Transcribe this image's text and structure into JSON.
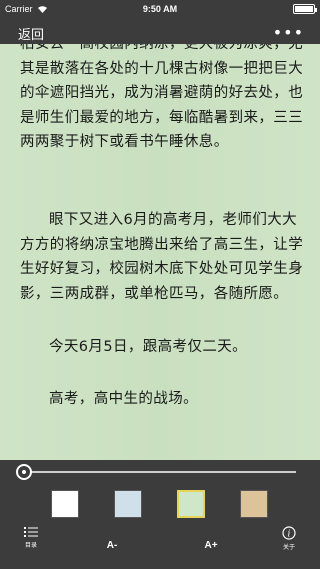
{
  "status_bar": {
    "carrier": "Carrier",
    "time": "9:50 AM"
  },
  "nav": {
    "back_label": "返回",
    "more_label": "•••"
  },
  "content": {
    "paragraphs": [
      "柏安去一高校园内纳凉，更大被为凉爽，尤其是散落在各处的十几棵古树像一把把巨大的伞遮阳挡光，成为消暑避荫的好去处，也是师生们最爱的地方，每临酷暑到来，三三两两聚于树下或看书午睡休息。",
      "眼下又进入6月的高考月，老师们大大方方的将纳凉宝地腾出来给了高三生，让学生好好复习，校园树木底下处处可见学生身影，三两成群，或单枪匹马，各随所愿。",
      "今天6月5日，跟高考仅二天。",
      "高考，高中生的战场。"
    ]
  },
  "controls": {
    "progress": 0.0,
    "themes": [
      {
        "name": "white",
        "color": "#ffffff",
        "selected": false
      },
      {
        "name": "blue",
        "color": "#cfe0ea",
        "selected": false
      },
      {
        "name": "green",
        "color": "#cfe6c9",
        "selected": true
      },
      {
        "name": "tan",
        "color": "#dcc39a",
        "selected": false
      }
    ],
    "toc_label": "目录",
    "font_smaller_label": "A-",
    "font_larger_label": "A+",
    "about_label": "关于"
  }
}
